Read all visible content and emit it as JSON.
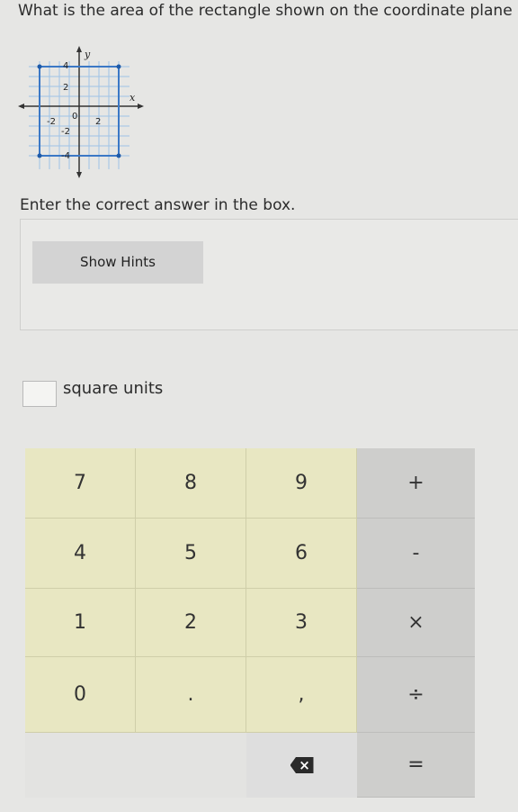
{
  "question": {
    "text": "What is the area of the rectangle shown on the coordinate plane"
  },
  "graph": {
    "x_axis_label": "x",
    "y_axis_label": "y",
    "x_tick_labels": [
      "-2",
      "0",
      "2"
    ],
    "y_tick_labels": [
      "4",
      "2",
      "-2",
      "-4"
    ],
    "rectangle_vertices": [
      [
        -4,
        4
      ],
      [
        4,
        4
      ],
      [
        4,
        -4
      ],
      [
        -4,
        -4
      ]
    ],
    "colors": {
      "rectangle": "#3b78c6",
      "grid": "#9fc3e6"
    }
  },
  "instruction": "Enter the correct answer in the box.",
  "hints": {
    "button_label": "Show Hints"
  },
  "answer": {
    "value": "",
    "unit_label": "square units"
  },
  "keypad": {
    "rows": [
      [
        "7",
        "8",
        "9",
        "+"
      ],
      [
        "4",
        "5",
        "6",
        "-"
      ],
      [
        "1",
        "2",
        "3",
        "×"
      ],
      [
        "0",
        ".",
        ",",
        "÷"
      ]
    ],
    "backspace_icon": "backspace-icon",
    "equals_label": "="
  },
  "colors": {
    "number_keys": "#e8e7c2",
    "operator_keys": "#cececc",
    "background": "#e6e6e4"
  }
}
